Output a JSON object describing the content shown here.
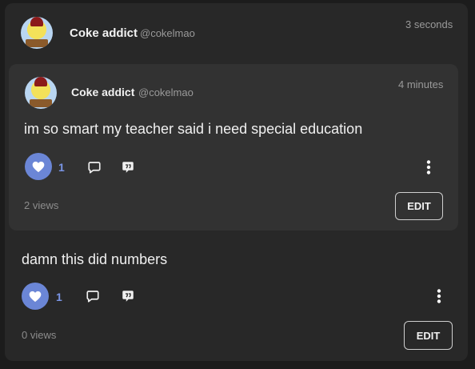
{
  "outer_post": {
    "author_name": "Coke addict",
    "author_handle": "@cokelmao",
    "timestamp": "3 seconds",
    "text": "damn this did numbers",
    "like_count": "1",
    "views": "0 views",
    "edit_label": "EDIT"
  },
  "quoted_post": {
    "author_name": "Coke addict",
    "author_handle": "@cokelmao",
    "timestamp": "4 minutes",
    "text": "im so smart my teacher said i need special education",
    "like_count": "1",
    "views": "2 views",
    "edit_label": "EDIT"
  },
  "icons": {
    "like": "heart-icon",
    "comment": "comment-icon",
    "quote": "quote-icon",
    "more": "more-vertical-icon"
  },
  "colors": {
    "accent": "#6b86d6",
    "like_count": "#7a95e6"
  }
}
